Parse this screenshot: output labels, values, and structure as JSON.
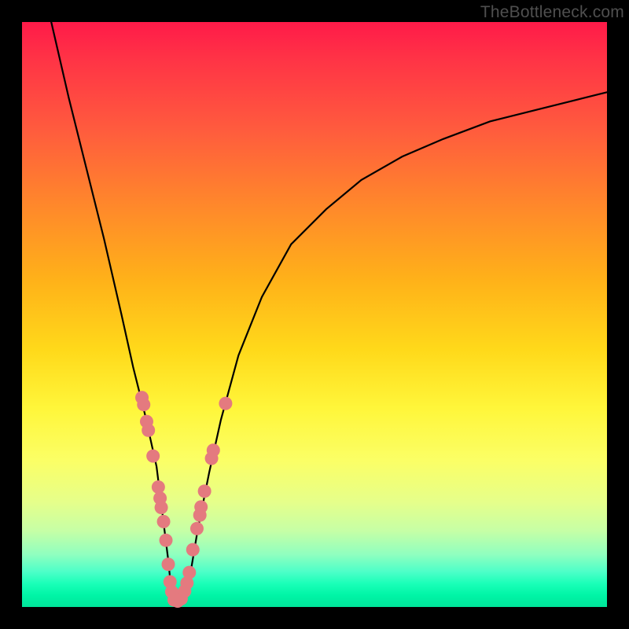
{
  "watermark": "TheBottleneck.com",
  "colors": {
    "frame": "#000000",
    "accent_dot": "#e47a7f",
    "curve": "#000000"
  },
  "chart_data": {
    "type": "line",
    "title": "",
    "xlabel": "",
    "ylabel": "",
    "xlim": [
      0,
      100
    ],
    "ylim": [
      0,
      100
    ],
    "grid": false,
    "series": [
      {
        "name": "bottleneck-curve",
        "x": [
          5,
          8,
          11,
          14,
          17,
          19,
          21,
          23,
          24,
          25,
          25.5,
          26,
          27,
          28,
          29,
          30,
          32,
          34,
          37,
          41,
          46,
          52,
          58,
          65,
          72,
          80,
          88,
          96,
          100
        ],
        "y": [
          100,
          87,
          75,
          63,
          50,
          41,
          33,
          24,
          16,
          8,
          3,
          1,
          1,
          3,
          7,
          13,
          23,
          32,
          43,
          53,
          62,
          68,
          73,
          77,
          80,
          83,
          85,
          87,
          88
        ]
      }
    ],
    "points": [
      {
        "x": 20.5,
        "y": 35.8
      },
      {
        "x": 20.8,
        "y": 34.6
      },
      {
        "x": 21.3,
        "y": 31.7
      },
      {
        "x": 21.6,
        "y": 30.2
      },
      {
        "x": 22.4,
        "y": 25.8
      },
      {
        "x": 23.3,
        "y": 20.5
      },
      {
        "x": 23.6,
        "y": 18.6
      },
      {
        "x": 23.8,
        "y": 17.0
      },
      {
        "x": 24.2,
        "y": 14.6
      },
      {
        "x": 24.6,
        "y": 11.4
      },
      {
        "x": 25.0,
        "y": 7.3
      },
      {
        "x": 25.3,
        "y": 4.3
      },
      {
        "x": 25.6,
        "y": 2.6
      },
      {
        "x": 26.0,
        "y": 1.2
      },
      {
        "x": 26.6,
        "y": 1.0
      },
      {
        "x": 27.2,
        "y": 1.4
      },
      {
        "x": 27.8,
        "y": 2.7
      },
      {
        "x": 28.2,
        "y": 4.1
      },
      {
        "x": 28.6,
        "y": 5.9
      },
      {
        "x": 29.2,
        "y": 9.8
      },
      {
        "x": 29.9,
        "y": 13.4
      },
      {
        "x": 30.4,
        "y": 15.7
      },
      {
        "x": 30.6,
        "y": 17.1
      },
      {
        "x": 31.2,
        "y": 19.8
      },
      {
        "x": 32.4,
        "y": 25.4
      },
      {
        "x": 32.7,
        "y": 26.8
      },
      {
        "x": 34.8,
        "y": 34.8
      }
    ],
    "annotations": [],
    "legend": false
  }
}
